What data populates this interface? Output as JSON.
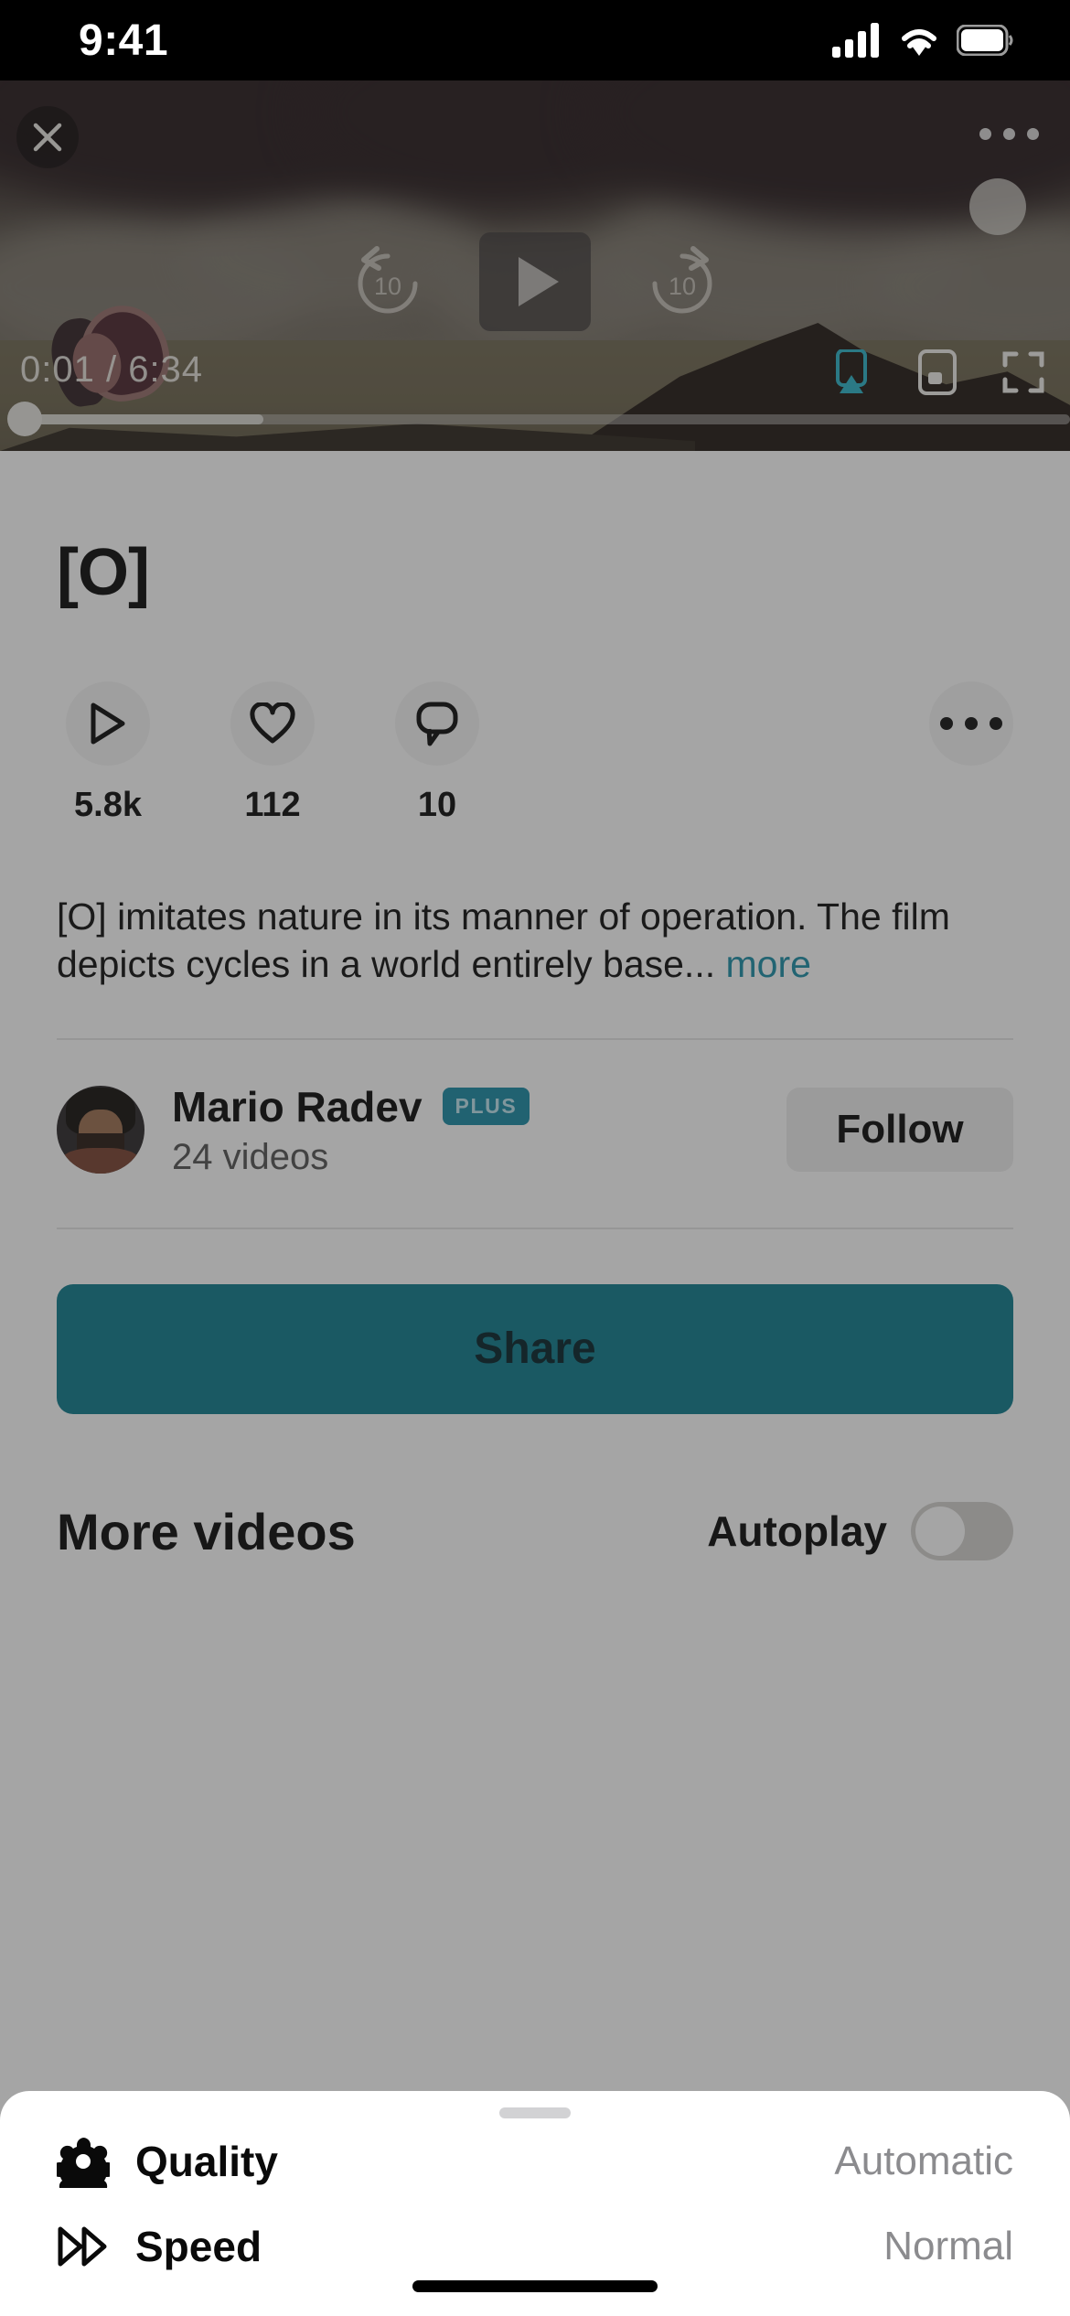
{
  "status_bar": {
    "time": "9:41",
    "icons": [
      "cellular-signal-icon",
      "wifi-icon",
      "battery-icon"
    ]
  },
  "player": {
    "close_icon": "close-icon",
    "more_icon": "more-options-icon",
    "rewind_label": "10",
    "forward_label": "10",
    "play_icon": "play-icon",
    "current_time": "0:01",
    "separator": "/",
    "duration": "6:34",
    "timecode": "0:01 / 6:34",
    "progress_percent": 0.25,
    "buffered_percent": 23,
    "airplay_icon": "airplay-icon",
    "pip_icon": "picture-in-picture-icon",
    "fullscreen_icon": "fullscreen-icon",
    "accent_color": "#2eb3c8"
  },
  "video": {
    "title": "[O]",
    "stats": [
      {
        "icon": "play-icon",
        "value": "5.8k",
        "name": "plays"
      },
      {
        "icon": "heart-icon",
        "value": "112",
        "name": "likes"
      },
      {
        "icon": "comment-icon",
        "value": "10",
        "name": "comments"
      }
    ],
    "overflow_icon": "more-options-icon",
    "description": "[O] imitates nature in its manner of operation. The film depicts cycles in a world entirely base...",
    "description_more": "more"
  },
  "creator": {
    "avatar": "user-avatar",
    "name": "Mario Radev",
    "badge": "PLUS",
    "video_count": "24 videos",
    "follow_label": "Follow"
  },
  "actions": {
    "share_label": "Share",
    "share_color": "#107c8e"
  },
  "more_videos": {
    "title": "More videos",
    "autoplay_label": "Autoplay",
    "autoplay_on": false
  },
  "sheet": {
    "grabber": "sheet-grabber",
    "rows": [
      {
        "icon": "gear-icon",
        "label": "Quality",
        "value": "Automatic"
      },
      {
        "icon": "speed-icon",
        "label": "Speed",
        "value": "Normal"
      }
    ]
  },
  "home_indicator": "home-indicator"
}
